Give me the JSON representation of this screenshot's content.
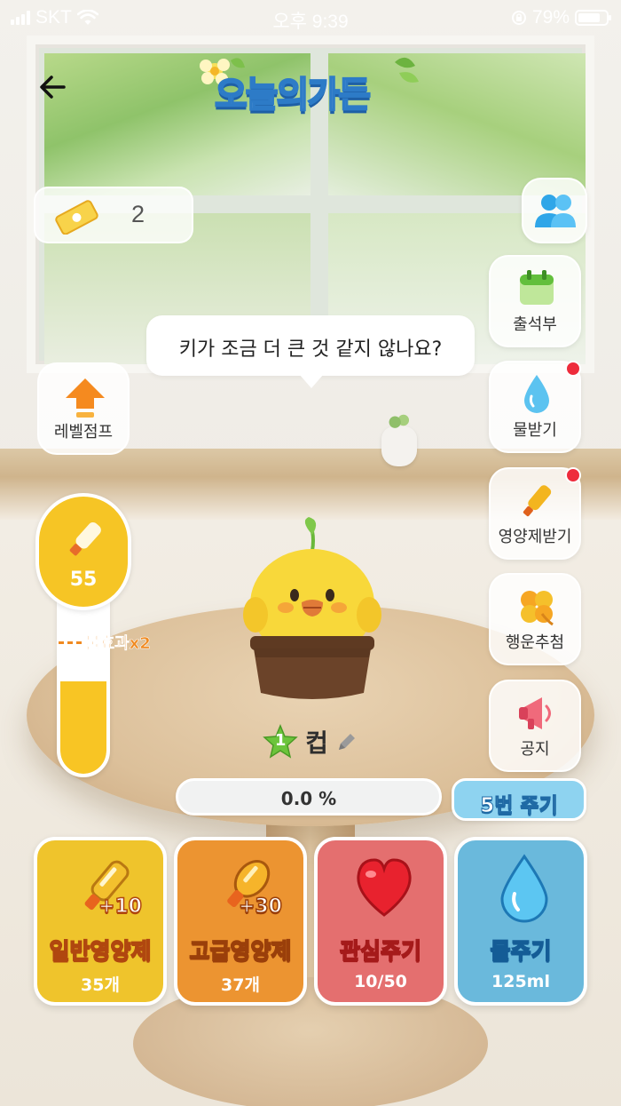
{
  "status_bar": {
    "carrier": "SKT",
    "time": "오후 9:39",
    "battery": "79%",
    "battery_level": 0.79
  },
  "header": {
    "logo_text": "오늘의가든"
  },
  "ticket": {
    "count": "2"
  },
  "side_menu": {
    "friends_label": "",
    "attendance_label": "출석부",
    "water_label": "물받기",
    "nutrient_label": "영양제받기",
    "lucky_label": "행운추첨",
    "notice_label": "공지"
  },
  "speech_bubble": {
    "text": "키가 조금 더 큰 것 같지 않나요?"
  },
  "level_jump": {
    "label": "레벨점프"
  },
  "gauge": {
    "value": "55",
    "fill_level": 0.55,
    "bonus_text": "물효과x2"
  },
  "plant": {
    "level": "1",
    "name": "컵",
    "progress": "0.0 %",
    "progress_level": 0.0
  },
  "cycle_button": {
    "label": "5번 주기"
  },
  "actions": [
    {
      "title": "일반영양제",
      "sub": "35개",
      "badge": "+10"
    },
    {
      "title": "고급영양제",
      "sub": "37개",
      "badge": "+30"
    },
    {
      "title": "관심주기",
      "sub": "10/50"
    },
    {
      "title": "물주기",
      "sub": "125ml"
    }
  ],
  "colors": {
    "accent_yellow": "#f6c525",
    "accent_orange": "#ec9431",
    "accent_red": "#e46f6f",
    "accent_blue": "#6ab9dc",
    "notification_dot": "#ee2c3c"
  }
}
